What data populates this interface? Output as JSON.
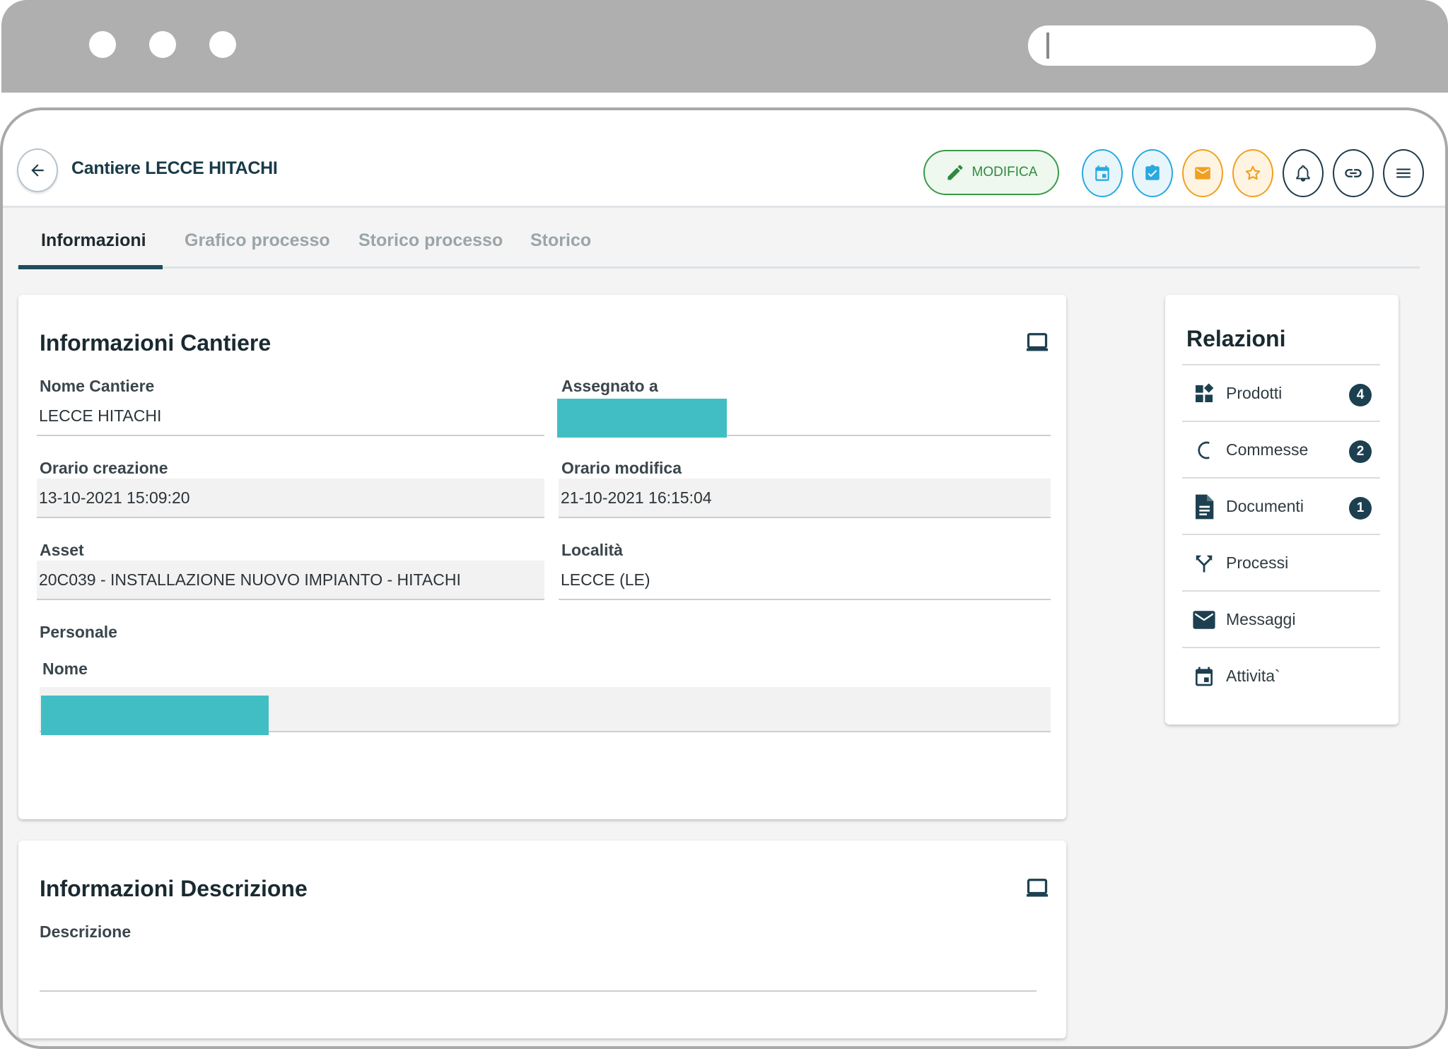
{
  "header": {
    "title": "Cantiere LECCE HITACHI",
    "edit_label": "MODIFICA"
  },
  "tabs": [
    {
      "label": "Informazioni",
      "active": true
    },
    {
      "label": "Grafico processo",
      "active": false
    },
    {
      "label": "Storico processo",
      "active": false
    },
    {
      "label": "Storico",
      "active": false
    }
  ],
  "info_card": {
    "title": "Informazioni Cantiere",
    "fields": {
      "nome_cantiere": {
        "label": "Nome Cantiere",
        "value": "LECCE HITACHI"
      },
      "assegnato": {
        "label": "Assegnato a",
        "value": ""
      },
      "orario_creazione": {
        "label": "Orario creazione",
        "value": "13-10-2021 15:09:20"
      },
      "orario_modifica": {
        "label": "Orario modifica",
        "value": "21-10-2021 16:15:04"
      },
      "asset": {
        "label": "Asset",
        "value": "20C039 - INSTALLAZIONE NUOVO IMPIANTO - HITACHI"
      },
      "localita": {
        "label": "Località",
        "value": "LECCE (LE)"
      }
    },
    "personale": {
      "label": "Personale",
      "column": "Nome"
    }
  },
  "desc_card": {
    "title": "Informazioni Descrizione",
    "field_label": "Descrizione",
    "value": ""
  },
  "relazioni": {
    "title": "Relazioni",
    "items": [
      {
        "label": "Prodotti",
        "count": "4",
        "icon": "products-icon"
      },
      {
        "label": "Commesse",
        "count": "2",
        "icon": "commesse-icon"
      },
      {
        "label": "Documenti",
        "count": "1",
        "icon": "document-icon"
      },
      {
        "label": "Processi",
        "count": "",
        "icon": "process-icon"
      },
      {
        "label": "Messaggi",
        "count": "",
        "icon": "mail-icon"
      },
      {
        "label": "Attivita`",
        "count": "",
        "icon": "calendar-icon"
      }
    ]
  },
  "colors": {
    "accent": "#1d4d5e",
    "edit_green": "#3a9a48",
    "blue": "#2aa8e0",
    "orange": "#f0a020",
    "redaction": "#41bec4"
  }
}
